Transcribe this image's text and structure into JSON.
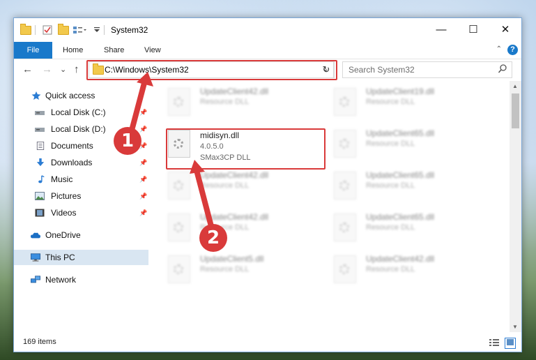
{
  "window": {
    "title": "System32",
    "controls": {
      "minimize": "—",
      "maximize": "☐",
      "close": "✕"
    }
  },
  "ribbon": {
    "file_tab": "File",
    "tabs": [
      "Home",
      "Share",
      "View"
    ],
    "help": "?"
  },
  "navigation": {
    "back": "←",
    "forward": "→",
    "recent": "⌄",
    "up": "↑",
    "address": "C:\\Windows\\System32",
    "refresh": "↻",
    "search_placeholder": "Search System32"
  },
  "sidebar": {
    "items": [
      {
        "label": "Quick access",
        "icon": "star-icon"
      },
      {
        "label": "Local Disk (C:)",
        "icon": "drive-icon",
        "pinned": true
      },
      {
        "label": "Local Disk (D:)",
        "icon": "drive-icon",
        "pinned": true
      },
      {
        "label": "Documents",
        "icon": "documents-icon",
        "pinned": true
      },
      {
        "label": "Downloads",
        "icon": "download-icon",
        "pinned": true
      },
      {
        "label": "Music",
        "icon": "music-icon",
        "pinned": true
      },
      {
        "label": "Pictures",
        "icon": "pictures-icon",
        "pinned": true
      },
      {
        "label": "Videos",
        "icon": "videos-icon",
        "pinned": true
      },
      {
        "label": "OneDrive",
        "icon": "cloud-icon"
      },
      {
        "label": "This PC",
        "icon": "computer-icon",
        "selected": true
      },
      {
        "label": "Network",
        "icon": "network-icon"
      }
    ]
  },
  "files": {
    "left_column": [
      {
        "name": "UpdateClient42.dll",
        "desc": "Resource DLL"
      },
      {
        "name": "midisyn.dll",
        "version": "4.0.5.0",
        "desc": "SMax3CP DLL",
        "highlighted": true
      },
      {
        "name": "UpdateClient42.dll",
        "desc": "Resource DLL"
      },
      {
        "name": "UpdateClient42.dll",
        "desc": "Resource DLL"
      },
      {
        "name": "UpdateClient5.dll",
        "desc": "Resource DLL"
      }
    ],
    "right_column": [
      {
        "name": "UpdateClient19.dll",
        "desc": "Resource DLL"
      },
      {
        "name": "UpdateClient65.dll",
        "desc": "Resource DLL"
      },
      {
        "name": "UpdateClient65.dll",
        "desc": "Resource DLL"
      },
      {
        "name": "UpdateClient65.dll",
        "desc": "Resource DLL"
      },
      {
        "name": "UpdateClient42.dll",
        "desc": "Resource DLL"
      }
    ]
  },
  "status": {
    "count": "169 items"
  },
  "annotations": {
    "step1": "1",
    "step2": "2",
    "color": "#d93a3a"
  }
}
